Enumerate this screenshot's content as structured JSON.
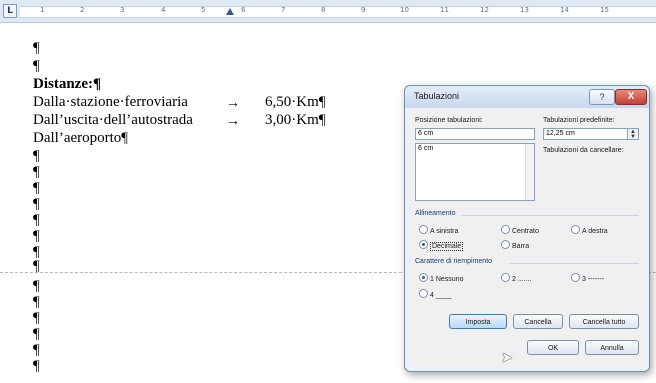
{
  "ruler": {
    "tab_selector": "L",
    "numbers": [
      "1",
      "2",
      "3",
      "4",
      "5",
      "6",
      "7",
      "8",
      "9",
      "10",
      "11",
      "12",
      "13",
      "14",
      "15"
    ]
  },
  "document": {
    "pilcrow": "¶",
    "heading": "Distanze:¶",
    "rows": [
      {
        "label": "Dalla·stazione·ferroviaria",
        "arrow": "→",
        "value": "6,50·Km¶"
      },
      {
        "label": "Dall’uscita·dell’autostrada",
        "arrow": "→",
        "value": "3,00·Km¶"
      }
    ],
    "last_line": "Dall’aeroporto¶"
  },
  "dialog": {
    "title": "Tabulazioni",
    "help_label": "?",
    "close_label": "X",
    "position_label": "Posizione tabulazioni:",
    "position_value": "6 cm",
    "list_items": [
      "6 cm"
    ],
    "default_label": "Tabulazioni predefinite:",
    "default_value": "12,25 cm",
    "clear_label": "Tabulazioni da cancellare:",
    "alignment_label": "Allineamento",
    "alignment_options": [
      {
        "label": "A sinistra",
        "selected": false
      },
      {
        "label": "Centrato",
        "selected": false
      },
      {
        "label": "A destra",
        "selected": false
      },
      {
        "label": "Decimale",
        "selected": true
      },
      {
        "label": "Barra",
        "selected": false
      }
    ],
    "leader_label": "Carattere di riempimento",
    "leader_options": [
      {
        "label": "1 Nessuno",
        "selected": true
      },
      {
        "label": "2 .......",
        "selected": false
      },
      {
        "label": "3 -------",
        "selected": false
      },
      {
        "label": "4 ____",
        "selected": false
      }
    ],
    "buttons": {
      "set": "Imposta",
      "clear": "Cancella",
      "clear_all": "Cancella tutto",
      "ok": "OK",
      "cancel": "Annulla"
    }
  }
}
